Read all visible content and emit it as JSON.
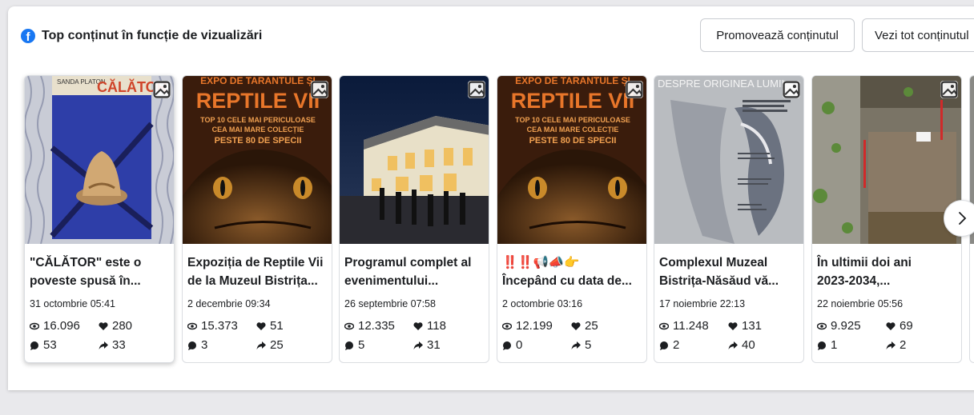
{
  "header": {
    "title": "Top conținut în funcție de vizualizări",
    "promote_button": "Promovează conținutul",
    "view_all_button": "Vezi tot conținutul"
  },
  "icons": {
    "brand": "facebook-icon",
    "media": "image-icon",
    "views": "eye-icon",
    "reactions": "heart-icon",
    "comments": "comment-icon",
    "shares": "share-icon",
    "next": "chevron-right-icon"
  },
  "colors": {
    "brand": "#1877f2"
  },
  "thumbnail_text": {
    "book_author": "SANDA PLATON",
    "book_title": "CĂLĂTOR",
    "expo_heading": "EXPO DE TARANTULE ȘI",
    "expo_title": "REPTILE VII",
    "expo_line1": "TOP 10 CELE MAI PERICULOASE",
    "expo_line2": "CEA MAI MARE COLECȚIE",
    "expo_line3": "PESTE 80 DE SPECII",
    "origin_title": "DESPRE ORIGINEA LUMII"
  },
  "posts": [
    {
      "title_line1": "\"CĂLĂTOR\" este o",
      "title_line2": "poveste spusă în...",
      "date": "31 octombrie 05:41",
      "views": "16.096",
      "reactions": "280",
      "comments": "53",
      "shares": "33"
    },
    {
      "title_line1": "Expoziția de Reptile Vii",
      "title_line2": "de la Muzeul Bistrița...",
      "date": "2 decembrie 09:34",
      "views": "15.373",
      "reactions": "51",
      "comments": "3",
      "shares": "25"
    },
    {
      "title_line1": "Programul complet al",
      "title_line2": "evenimentului...",
      "date": "26 septembrie 07:58",
      "views": "12.335",
      "reactions": "118",
      "comments": "5",
      "shares": "31"
    },
    {
      "title_line1": "‼️‼️📢📣👉",
      "title_line2": "Începând cu data de...",
      "date": "2 octombrie 03:16",
      "views": "12.199",
      "reactions": "25",
      "comments": "0",
      "shares": "5"
    },
    {
      "title_line1": "Complexul Muzeal",
      "title_line2": "Bistrița-Năsăud vă...",
      "date": "17 noiembrie 22:13",
      "views": "11.248",
      "reactions": "131",
      "comments": "2",
      "shares": "40"
    },
    {
      "title_line1": "În ultimii doi ani",
      "title_line2": "2023-2034,...",
      "date": "22 noiembrie 05:56",
      "views": "9.925",
      "reactions": "69",
      "comments": "1",
      "shares": "2"
    }
  ]
}
